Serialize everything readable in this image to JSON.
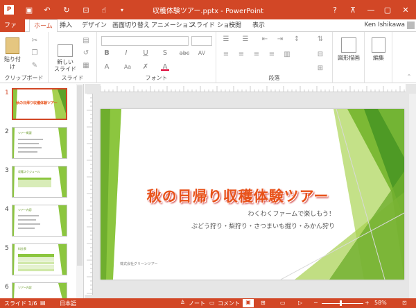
{
  "titlebar": {
    "title": "収穫体験ツアー.pptx - PowerPoint",
    "help": "?",
    "minimize": "—",
    "close": "✕"
  },
  "tabs": {
    "file": "ファイル",
    "home": "ホーム",
    "insert": "挿入",
    "design": "デザイン",
    "transitions": "画面切り替え",
    "animations": "アニメーション",
    "slideshow": "スライド ショー",
    "review": "校閲",
    "view": "表示"
  },
  "user": {
    "name": "Ken Ishikawa"
  },
  "ribbon": {
    "clipboard": {
      "label": "クリップボード",
      "paste_label": "貼り付け"
    },
    "slides": {
      "label": "スライド",
      "new_slide_label": "新しい\nスライド"
    },
    "font": {
      "label": "フォント",
      "bold": "B",
      "italic": "I",
      "underline": "U",
      "shadow": "S",
      "strike": "abc",
      "spacing": "AV",
      "grow": "A",
      "shrink": "A",
      "clear": "Aa",
      "color": "A"
    },
    "paragraph": {
      "label": "段落"
    },
    "drawing": {
      "shape_label": "図形描画"
    },
    "editing": {
      "label": "編集"
    }
  },
  "panel": {
    "slides": [
      {
        "num": "1",
        "title": "秋の日帰り収穫体験ツアー"
      },
      {
        "num": "2",
        "title": "ツアー概要"
      },
      {
        "num": "3",
        "title": "収穫スケジュール"
      },
      {
        "num": "4",
        "title": "ツアー内容"
      },
      {
        "num": "5",
        "title": "料金表"
      },
      {
        "num": "6",
        "title": "ツアー内容"
      }
    ]
  },
  "slide": {
    "title": "秋の日帰り収穫体験ツアー",
    "subtitle1": "わくわくファームで楽しもう！",
    "subtitle2": "ぶどう狩り・梨狩り・さつまいも掘り・みかん狩り",
    "footer": "株式会社グリーンツアー"
  },
  "status": {
    "slide": "スライド 1/6",
    "language": "日本語",
    "notes": "ノート",
    "comments": "コメント",
    "zoom": "58%"
  },
  "colors": {
    "accent": "#d24726",
    "green": "#8cc63f"
  }
}
